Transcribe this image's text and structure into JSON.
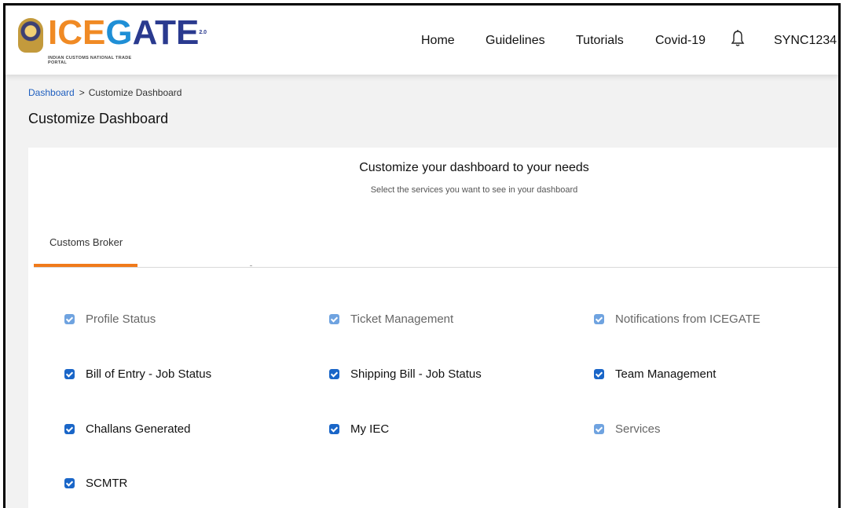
{
  "brand": {
    "logo_text_ice": "ICE",
    "logo_text_g": "G",
    "logo_text_ate": "ATE",
    "logo_suffix": "2.0",
    "tagline": "INDIAN CUSTOMS NATIONAL TRADE PORTAL"
  },
  "nav": {
    "items": [
      {
        "label": "Home"
      },
      {
        "label": "Guidelines"
      },
      {
        "label": "Tutorials"
      },
      {
        "label": "Covid-19"
      }
    ],
    "notification_icon": "bell-icon",
    "user": "SYNC1234"
  },
  "breadcrumb": {
    "root": "Dashboard",
    "separator": ">",
    "current": "Customize Dashboard"
  },
  "page_title": "Customize Dashboard",
  "panel": {
    "heading": "Customize your dashboard to your needs",
    "subheading": "Select the services you want to see in your dashboard",
    "tabs": [
      {
        "label": "Customs Broker",
        "active": true
      }
    ],
    "options": [
      {
        "label": "Profile Status",
        "checked": true,
        "disabled": true
      },
      {
        "label": "Ticket Management",
        "checked": true,
        "disabled": true
      },
      {
        "label": "Notifications from ICEGATE",
        "checked": true,
        "disabled": true
      },
      {
        "label": "Bill of Entry - Job Status",
        "checked": true,
        "disabled": false
      },
      {
        "label": "Shipping Bill - Job Status",
        "checked": true,
        "disabled": false
      },
      {
        "label": "Team Management",
        "checked": true,
        "disabled": false
      },
      {
        "label": "Challans Generated",
        "checked": true,
        "disabled": false
      },
      {
        "label": "My IEC",
        "checked": true,
        "disabled": false
      },
      {
        "label": "Services",
        "checked": true,
        "disabled": true
      },
      {
        "label": "SCMTR",
        "checked": true,
        "disabled": false
      }
    ]
  },
  "colors": {
    "accent_orange": "#f07a1a",
    "checkbox_blue": "#1a66c8",
    "checkbox_disabled_blue": "#6fa3e0",
    "link_blue": "#1f5fbf"
  }
}
